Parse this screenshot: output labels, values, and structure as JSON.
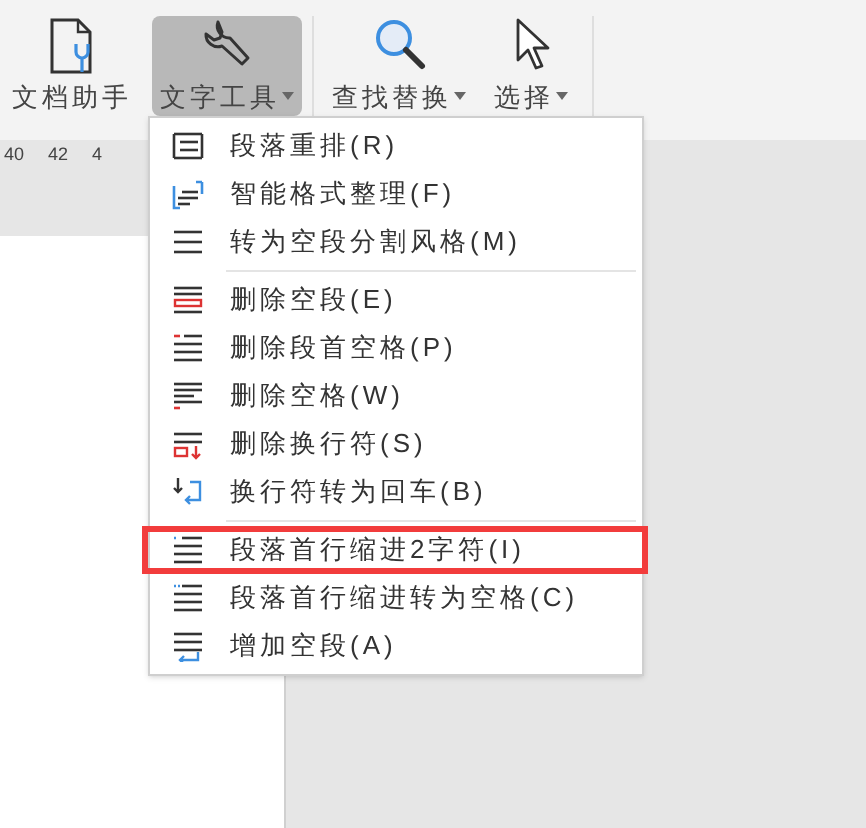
{
  "toolbar": {
    "buttons": [
      {
        "label": "文档助手",
        "kind": "doc",
        "selected": false,
        "dropdown": false
      },
      {
        "label": "文字工具",
        "kind": "wrench",
        "selected": true,
        "dropdown": true
      },
      {
        "label": "查找替换",
        "kind": "search",
        "selected": false,
        "dropdown": true
      },
      {
        "label": "选择",
        "kind": "pointer",
        "selected": false,
        "dropdown": true
      }
    ]
  },
  "ruler": {
    "labels": [
      "40",
      "42",
      "4"
    ]
  },
  "menu": {
    "items": [
      {
        "kind": "item",
        "label": "段落重排(R)",
        "highlighted": false
      },
      {
        "kind": "item",
        "label": "智能格式整理(F)",
        "highlighted": false
      },
      {
        "kind": "item",
        "label": "转为空段分割风格(M)",
        "highlighted": false
      },
      {
        "kind": "divider"
      },
      {
        "kind": "item",
        "label": "删除空段(E)",
        "highlighted": false
      },
      {
        "kind": "item",
        "label": "删除段首空格(P)",
        "highlighted": false
      },
      {
        "kind": "item",
        "label": "删除空格(W)",
        "highlighted": false
      },
      {
        "kind": "item",
        "label": "删除换行符(S)",
        "highlighted": false
      },
      {
        "kind": "item",
        "label": "换行符转为回车(B)",
        "highlighted": false
      },
      {
        "kind": "divider"
      },
      {
        "kind": "item",
        "label": "段落首行缩进2字符(I)",
        "highlighted": true
      },
      {
        "kind": "item",
        "label": "段落首行缩进转为空格(C)",
        "highlighted": false
      },
      {
        "kind": "item",
        "label": "增加空段(A)",
        "highlighted": false
      }
    ]
  }
}
